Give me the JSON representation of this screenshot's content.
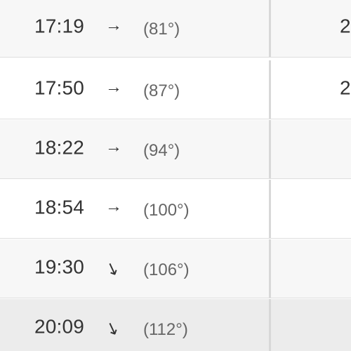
{
  "rows": [
    {
      "time": "17:19",
      "arrow": "→",
      "direction": "east",
      "angle": "(81°)",
      "next": "2"
    },
    {
      "time": "17:50",
      "arrow": "→",
      "direction": "east",
      "angle": "(87°)",
      "next": "2"
    },
    {
      "time": "18:22",
      "arrow": "→",
      "direction": "east",
      "angle": "(94°)",
      "next": ""
    },
    {
      "time": "18:54",
      "arrow": "→",
      "direction": "east",
      "angle": "(100°)",
      "next": ""
    },
    {
      "time": "19:30",
      "arrow": "↘",
      "direction": "southeast",
      "angle": "(106°)",
      "next": ""
    },
    {
      "time": "20:09",
      "arrow": "↘",
      "direction": "southeast",
      "angle": "(112°)",
      "next": ""
    }
  ],
  "colors": {
    "text": "#333333",
    "muted": "#666666",
    "row_alt": "#f7f7f7",
    "row_highlight": "#ececec",
    "divider": "#d8d8d8"
  }
}
